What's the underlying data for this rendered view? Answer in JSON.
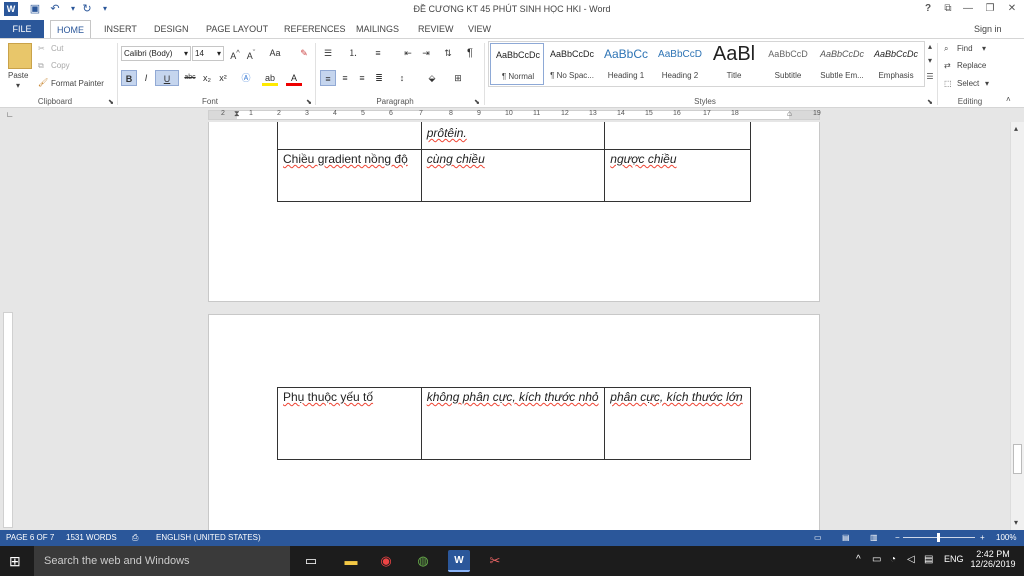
{
  "window": {
    "title": "ĐỀ CƯƠNG KT 45 PHÚT SINH HỌC HKI - Word",
    "help": "?",
    "sign_in": "Sign in"
  },
  "quick_access": {
    "undo": "↶",
    "redo": "↷",
    "save": "💾",
    "customize": "▾"
  },
  "tabs": [
    "FILE",
    "HOME",
    "INSERT",
    "DESIGN",
    "PAGE LAYOUT",
    "REFERENCES",
    "MAILINGS",
    "REVIEW",
    "VIEW"
  ],
  "ribbon": {
    "clipboard": {
      "paste": "Paste",
      "cut": "Cut",
      "copy": "Copy",
      "format_painter": "Format Painter",
      "label": "Clipboard"
    },
    "font": {
      "name": "Calibri (Body)",
      "size": "14",
      "change_case": "Aa",
      "bold": "B",
      "italic": "I",
      "underline": "U",
      "strike": "abc",
      "subscript": "x₂",
      "superscript": "x²",
      "label": "Font"
    },
    "paragraph": {
      "pilcrow": "¶",
      "label": "Paragraph"
    },
    "styles": {
      "label": "Styles",
      "items": [
        {
          "preview": "AaBbCcDc",
          "label": "¶ Normal"
        },
        {
          "preview": "AaBbCcDc",
          "label": "¶ No Spac..."
        },
        {
          "preview": "AaBbCc",
          "label": "Heading 1"
        },
        {
          "preview": "AaBbCcD",
          "label": "Heading 2"
        },
        {
          "preview": "AaBl",
          "label": "Title"
        },
        {
          "preview": "AaBbCcD",
          "label": "Subtitle"
        },
        {
          "preview": "AaBbCcDc",
          "label": "Subtle Em..."
        },
        {
          "preview": "AaBbCcDc",
          "label": "Emphasis"
        }
      ]
    },
    "editing": {
      "find": "Find",
      "replace": "Replace",
      "select": "Select",
      "label": "Editing"
    }
  },
  "ruler": {
    "numbers": [
      "2",
      "1",
      "1",
      "2",
      "3",
      "4",
      "5",
      "6",
      "7",
      "8",
      "9",
      "10",
      "11",
      "12",
      "13",
      "14",
      "15",
      "16",
      "17",
      "18",
      "19"
    ]
  },
  "document": {
    "table1": {
      "rows": [
        {
          "c1": "",
          "c2": "prôtêin.",
          "c3": ""
        },
        {
          "c1": "Chiều gradient nồng độ",
          "c2": "cùng chiều",
          "c3": "ngược chiều"
        }
      ]
    },
    "table2": {
      "rows": [
        {
          "c1": "Phụ thuộc yếu tố",
          "c2": "không phân cực, kích thước nhỏ",
          "c3": "phân cực, kích thước lớn"
        }
      ]
    }
  },
  "status": {
    "page": "PAGE 6 OF 7",
    "words": "1531 WORDS",
    "language": "ENGLISH (UNITED STATES)",
    "zoom": "100%",
    "zoom_minus": "−",
    "zoom_plus": "+"
  },
  "taskbar": {
    "search_placeholder": "Search the web and Windows",
    "lang": "ENG",
    "time": "2:42 PM",
    "date": "12/26/2019"
  },
  "colors": {
    "accent": "#2b579a",
    "taskbar": "#1c1c1c",
    "squiggle": "#e43333"
  }
}
